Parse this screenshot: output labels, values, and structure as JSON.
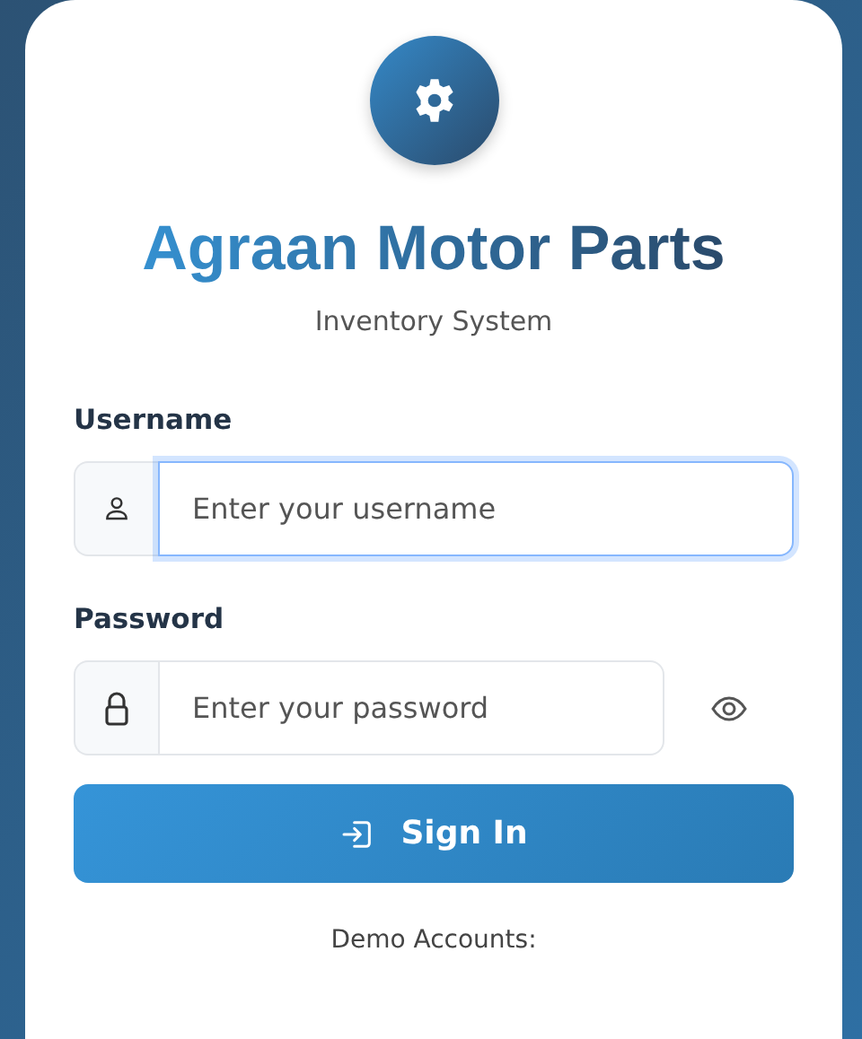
{
  "app": {
    "title": "Agraan Motor Parts",
    "subtitle": "Inventory System"
  },
  "fields": [
    {
      "kind": "text",
      "label": "Username",
      "placeholder": "Enter your username",
      "focused": true
    },
    {
      "kind": "password",
      "label": "Password",
      "placeholder": "Enter your password",
      "focused": false
    }
  ],
  "submit": {
    "label": "Sign In"
  },
  "demo": {
    "heading": "Demo Accounts:"
  }
}
